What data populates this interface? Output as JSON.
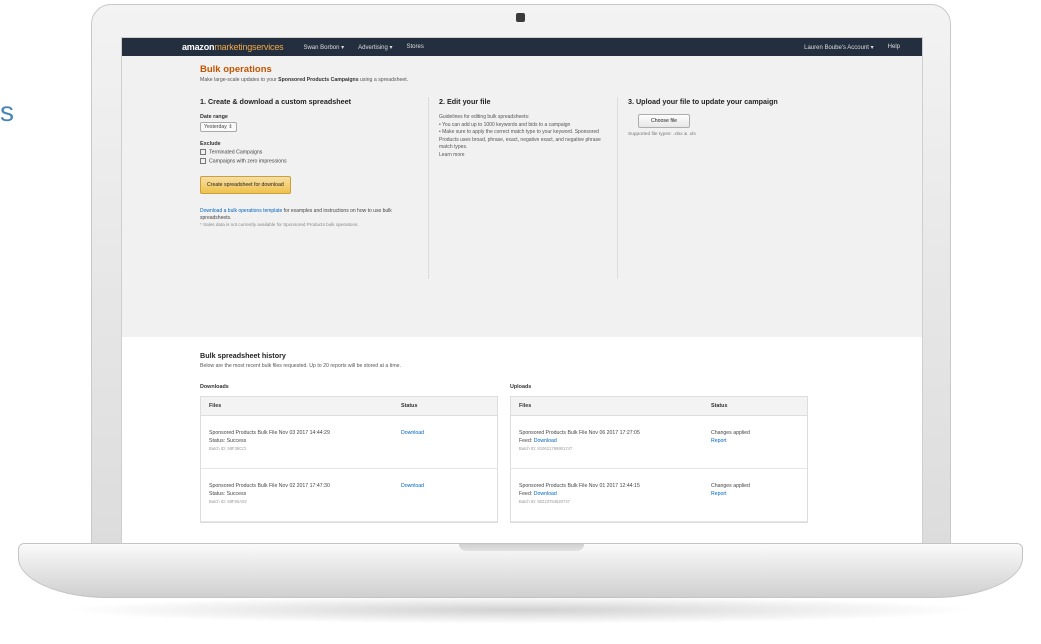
{
  "edge_text": "s",
  "nav": {
    "logo_main": "amazon",
    "logo_sub": "marketingservices",
    "brand": "Swan Borbon ▾",
    "advertising": "Advertising ▾",
    "stores": "Stores",
    "account": "Lauren Boube's Account ▾",
    "help": "Help"
  },
  "page": {
    "title": "Bulk operations",
    "subtitle_pre": "Make large-scale updates to your ",
    "subtitle_bold": "Sponsored Products Campaigns",
    "subtitle_post": " using a spreadsheet."
  },
  "step1": {
    "heading": "1. Create & download a custom spreadsheet",
    "date_range_label": "Date range",
    "date_range_value": "Yesterday ⇕",
    "exclude_label": "Exclude",
    "exclude_options": [
      "Terminated Campaigns",
      "Campaigns with zero impressions"
    ],
    "create_button": "Create spreadsheet for download",
    "template_link": "Download a bulk operations template",
    "template_text": " for examples and instructions on how to use bulk spreadsheets.",
    "note": "* Sales data is not currently available for Sponsored Products bulk operations."
  },
  "step2": {
    "heading": "2. Edit your file",
    "intro": "Guidelines for editing bulk spreadsheets:",
    "bullet1": "• You can add up to 1000 keywords and bids to a campaign",
    "bullet2": "• Make sure to apply the correct match type to your keyword. Sponsored Products uses broad, phrase, exact, negative exact, and negative phrase match types.",
    "learn_more": "Learn more"
  },
  "step3": {
    "heading": "3. Upload your file to update your campaign",
    "choose_button": "Choose file",
    "supported": "Supported file types: .xlsx & .xls"
  },
  "history": {
    "heading": "Bulk spreadsheet history",
    "subtitle": "Below are the most recent bulk files requested. Up to 20 reports will be stored at a time.",
    "downloads": {
      "title": "Downloads",
      "col_files": "Files",
      "col_status": "Status",
      "rows": [
        {
          "file": "Sponsored Products Bulk File Nov 03 2017 14:44:29",
          "status_line": "Status: Success",
          "batch": "Batch ID: 58F38CCI",
          "action": "Download"
        },
        {
          "file": "Sponsored Products Bulk File Nov 02 2017 17:47:30",
          "status_line": "Status: Success",
          "batch": "Batch ID: 58F50A02",
          "action": "Download"
        }
      ]
    },
    "uploads": {
      "title": "Uploads",
      "col_files": "Files",
      "col_status": "Status",
      "rows": [
        {
          "file": "Sponsored Products Bulk File Nov 06 2017 17:27:05",
          "feed_label": "Feed: ",
          "feed_link": "Download",
          "batch": "Batch ID: 810621769901747",
          "status": "Changes applied",
          "report": "Report"
        },
        {
          "file": "Sponsored Products Bulk File Nov 01 2017 12:44:15",
          "feed_label": "Feed: ",
          "feed_link": "Download",
          "batch": "Batch ID: 80223784620747",
          "status": "Changes applied",
          "report": "Report"
        }
      ]
    }
  }
}
